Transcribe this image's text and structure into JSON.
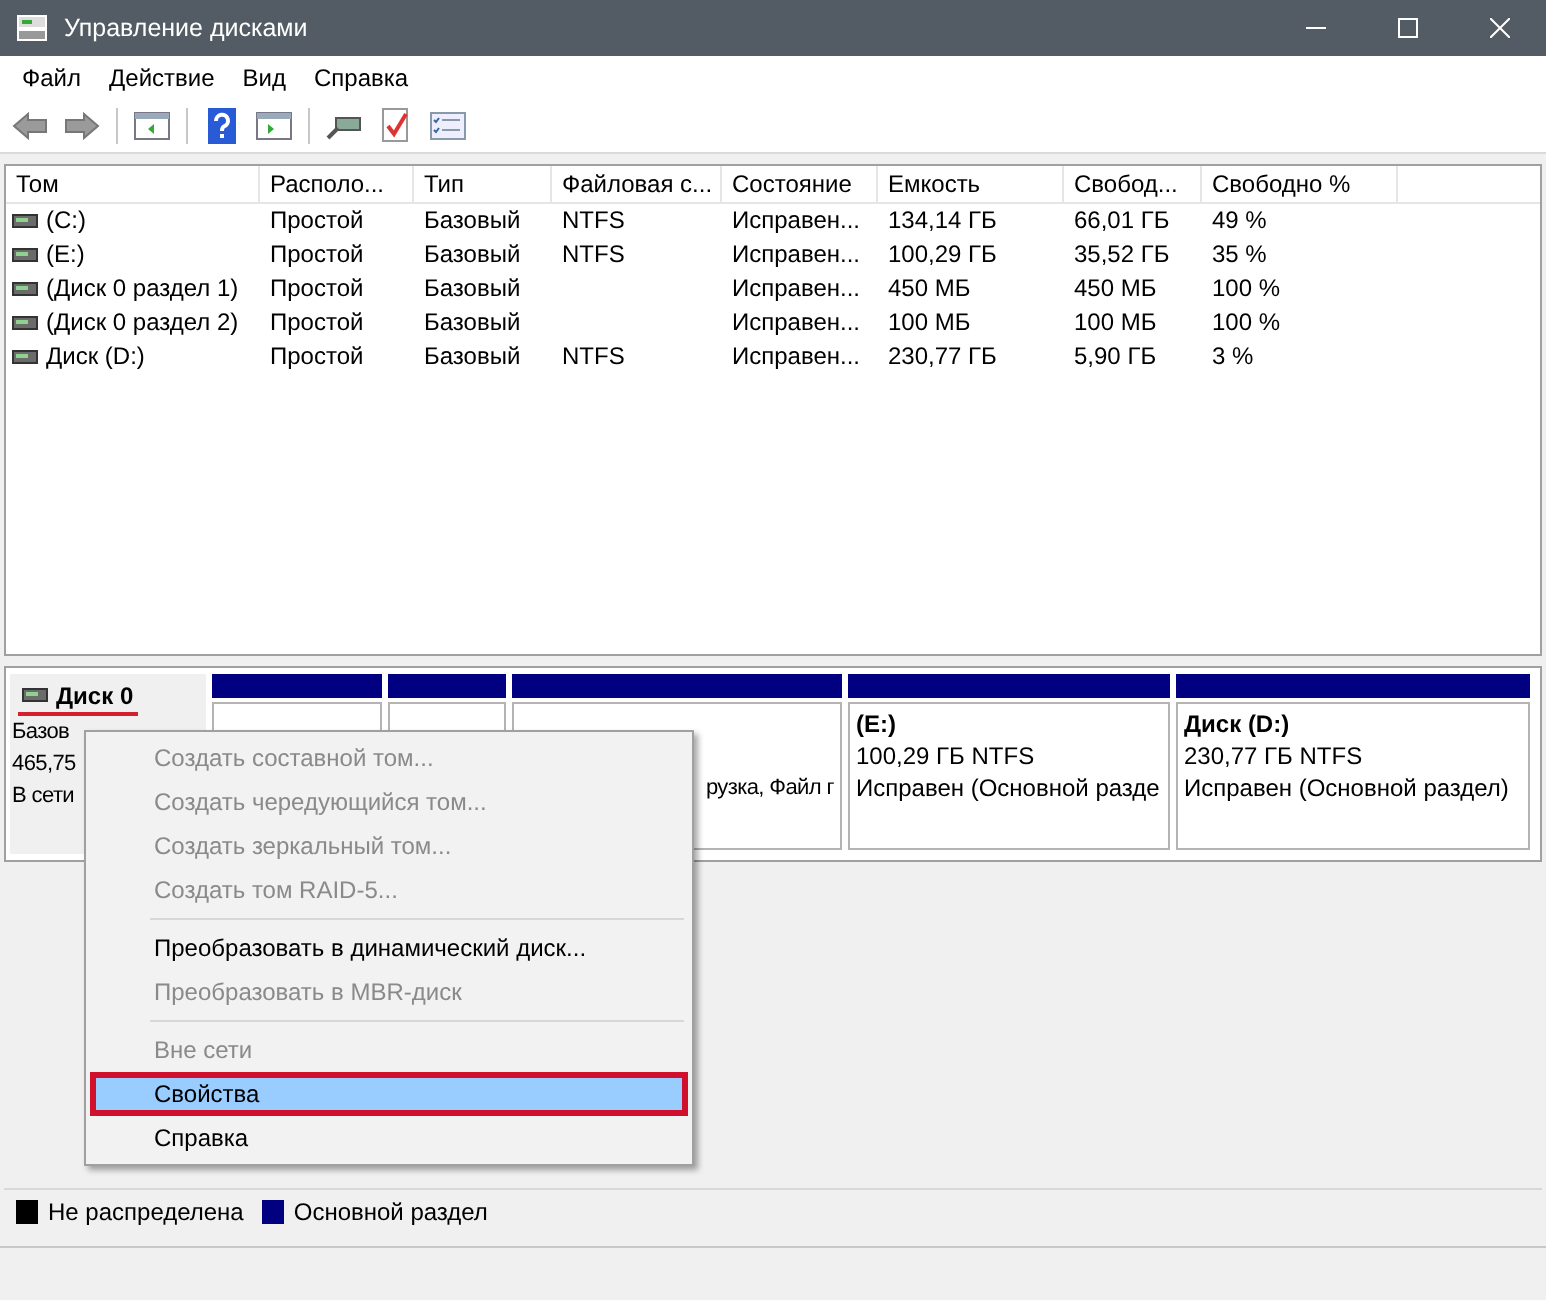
{
  "window": {
    "title": "Управление дисками"
  },
  "menu": [
    "Файл",
    "Действие",
    "Вид",
    "Справка"
  ],
  "volumes": {
    "columns": [
      "Том",
      "Располо...",
      "Тип",
      "Файловая с...",
      "Состояние",
      "Емкость",
      "Свобод...",
      "Свободно %"
    ],
    "rows": [
      {
        "cells": [
          "(C:)",
          "Простой",
          "Базовый",
          "NTFS",
          "Исправен...",
          "134,14 ГБ",
          "66,01 ГБ",
          "49 %"
        ]
      },
      {
        "cells": [
          "(E:)",
          "Простой",
          "Базовый",
          "NTFS",
          "Исправен...",
          "100,29 ГБ",
          "35,52 ГБ",
          "35 %"
        ]
      },
      {
        "cells": [
          "(Диск 0 раздел 1)",
          "Простой",
          "Базовый",
          "",
          "Исправен...",
          "450 МБ",
          "450 МБ",
          "100 %"
        ]
      },
      {
        "cells": [
          "(Диск 0 раздел 2)",
          "Простой",
          "Базовый",
          "",
          "Исправен...",
          "100 МБ",
          "100 МБ",
          "100 %"
        ]
      },
      {
        "cells": [
          "Диск (D:)",
          "Простой",
          "Базовый",
          "NTFS",
          "Исправен...",
          "230,77 ГБ",
          "5,90 ГБ",
          "3 %"
        ]
      }
    ]
  },
  "disk": {
    "name": "Диск 0",
    "underlined": true,
    "lines": [
      "Базов",
      "465,75",
      "В сети"
    ],
    "partitions": [
      {
        "kind": "primary"
      },
      {
        "kind": "primary"
      },
      {
        "kind": "primary",
        "status": "рузка, Файл г"
      },
      {
        "kind": "primary",
        "title": "(E:)",
        "size": "100,29 ГБ NTFS",
        "status": "Исправен (Основной разде"
      },
      {
        "kind": "primary",
        "title": "Диск  (D:)",
        "size": "230,77 ГБ NTFS",
        "status": "Исправен (Основной раздел)"
      }
    ]
  },
  "context_menu": [
    {
      "kind": "item",
      "label": "Создать составной том...",
      "disabled": true,
      "selected": false
    },
    {
      "kind": "item",
      "label": "Создать чередующийся том...",
      "disabled": true,
      "selected": false
    },
    {
      "kind": "item",
      "label": "Создать зеркальный том...",
      "disabled": true,
      "selected": false
    },
    {
      "kind": "item",
      "label": "Создать том RAID-5...",
      "disabled": true,
      "selected": false
    },
    {
      "kind": "separator"
    },
    {
      "kind": "item",
      "label": "Преобразовать в динамический диск...",
      "disabled": false,
      "selected": false
    },
    {
      "kind": "item",
      "label": "Преобразовать в MBR-диск",
      "disabled": true,
      "selected": false
    },
    {
      "kind": "separator"
    },
    {
      "kind": "item",
      "label": "Вне сети",
      "disabled": true,
      "selected": false
    },
    {
      "kind": "item",
      "label": "Свойства",
      "disabled": false,
      "selected": true
    },
    {
      "kind": "item",
      "label": "Справка",
      "disabled": false,
      "selected": false
    }
  ],
  "legend": [
    {
      "label": "Не распределена",
      "color": "#000000"
    },
    {
      "label": "Основной раздел",
      "color": "#000080"
    }
  ]
}
